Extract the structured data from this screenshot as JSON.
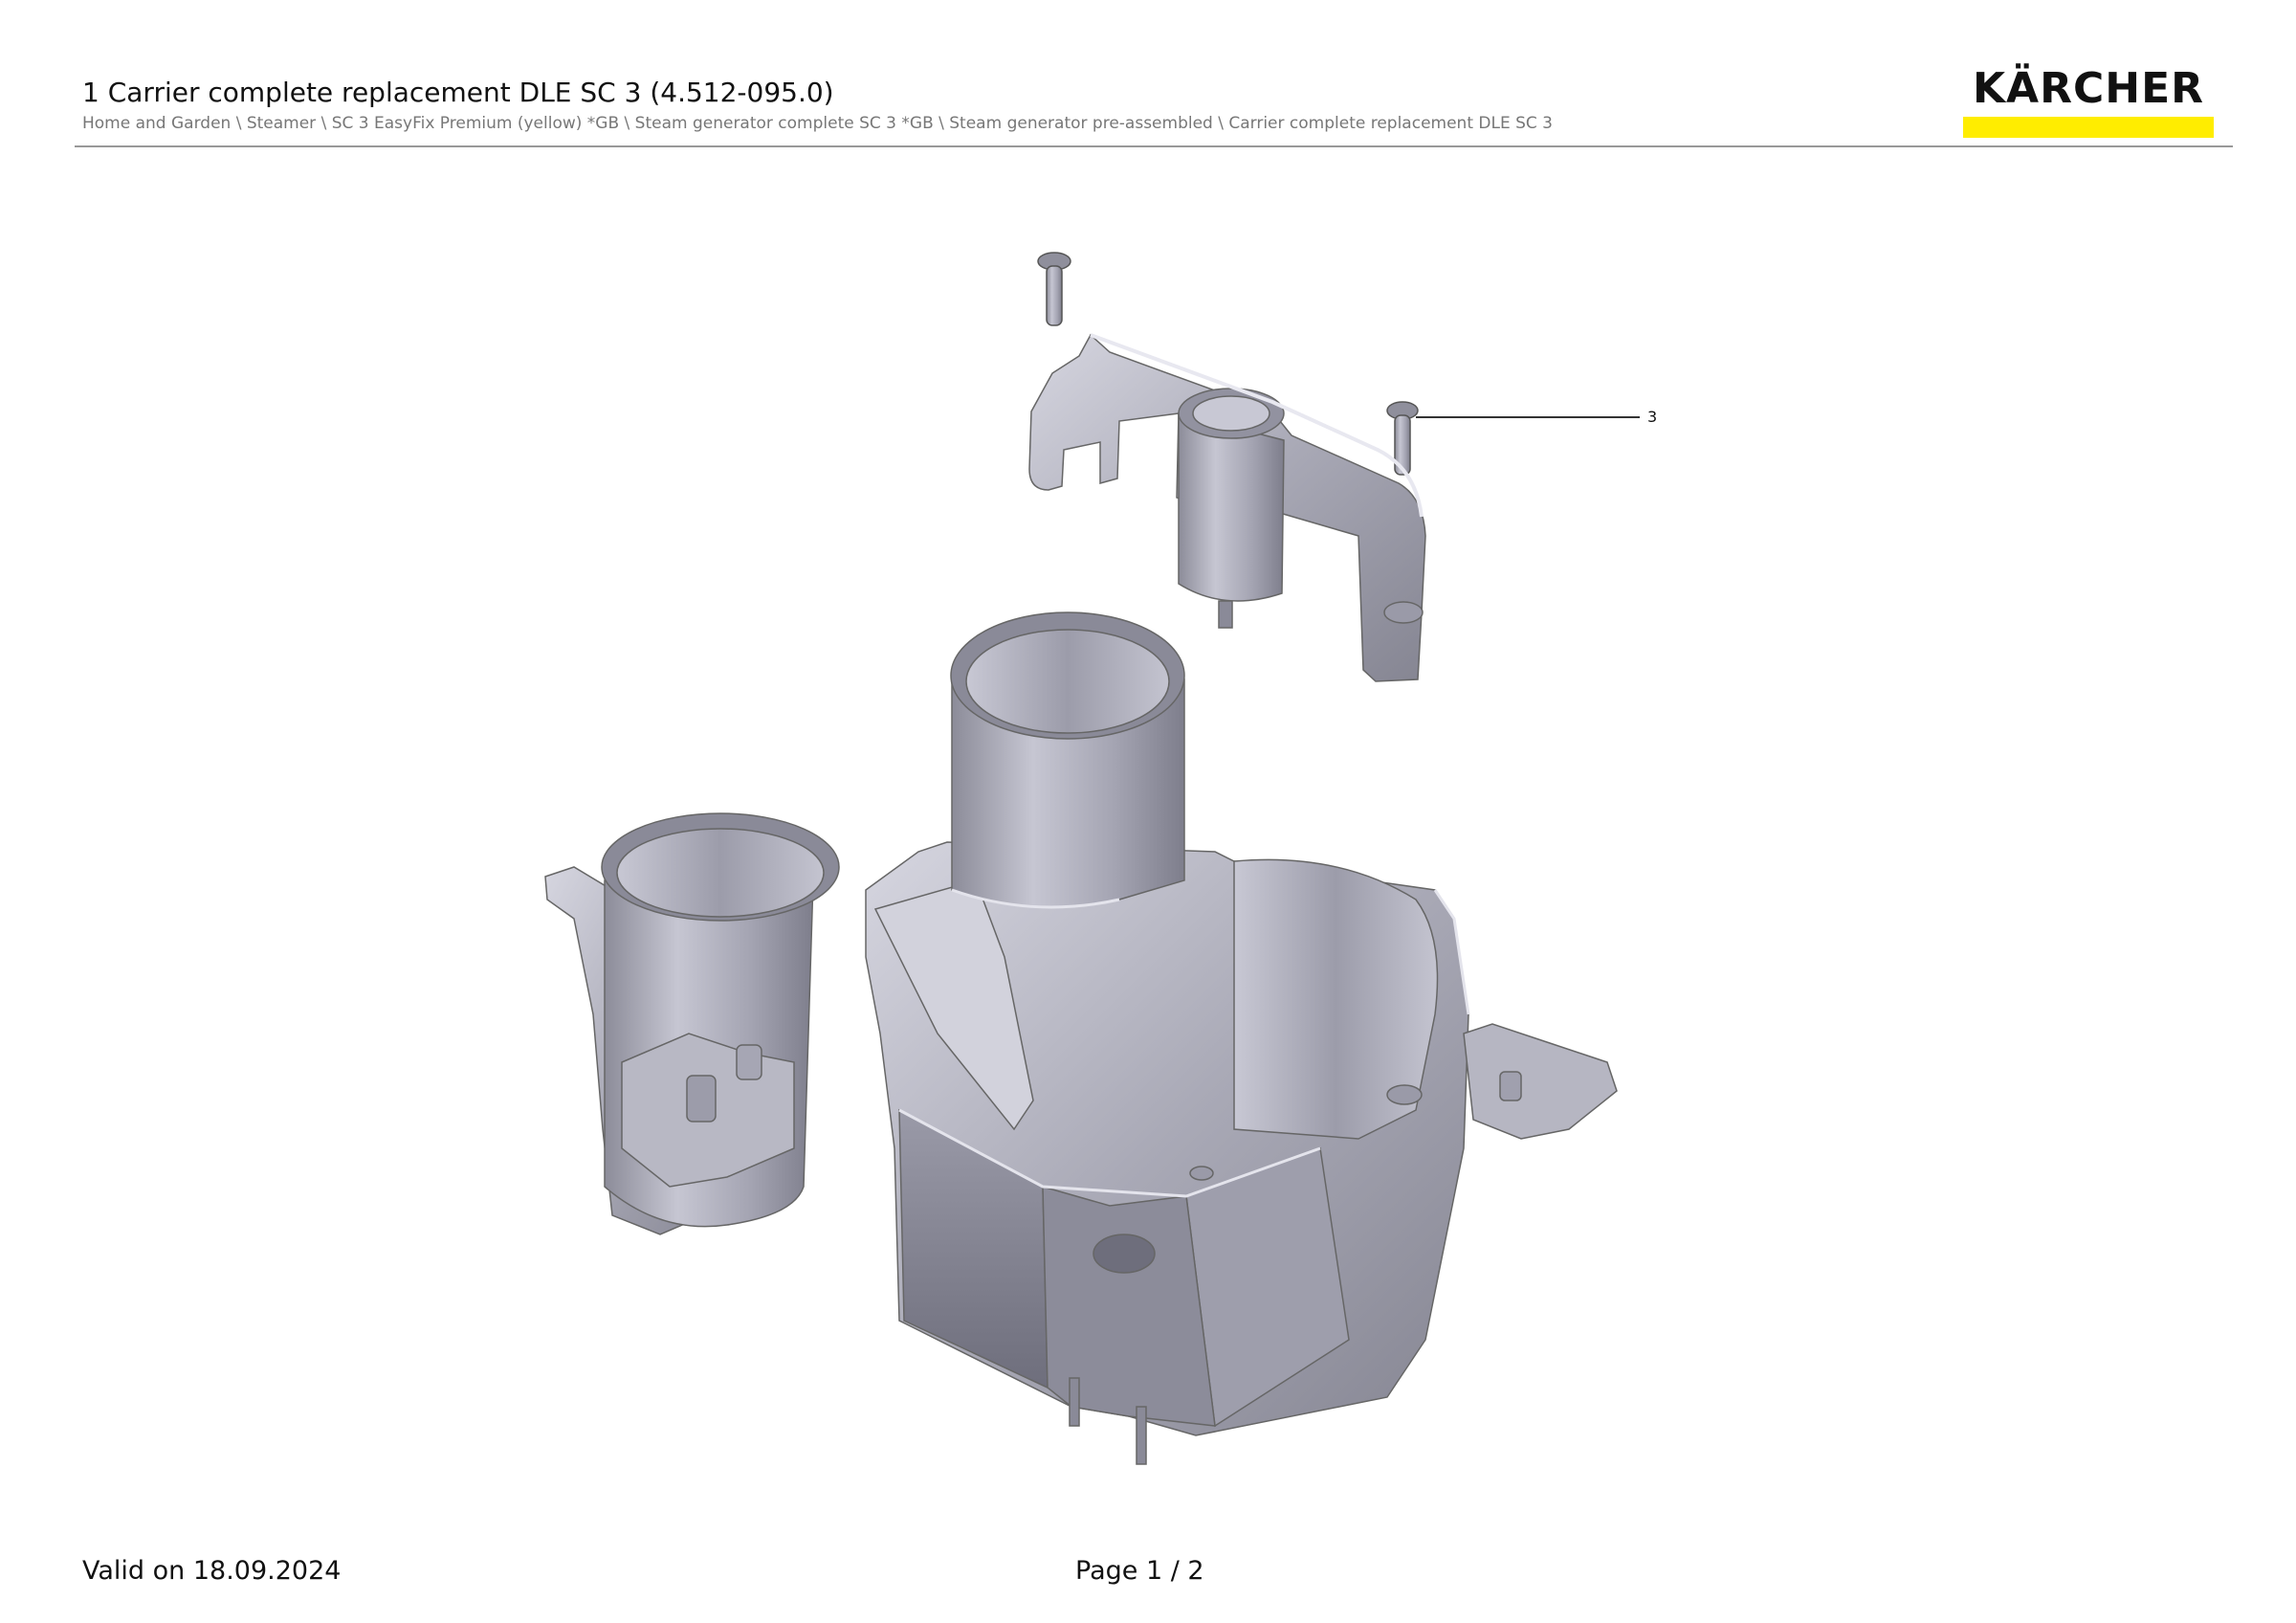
{
  "header": {
    "title": "1 Carrier complete replacement DLE SC 3 (4.512-095.0)",
    "breadcrumb": "Home and Garden \\ Steamer \\ SC 3 EasyFix Premium (yellow) *GB \\ Steam generator complete SC 3 *GB \\ Steam generator pre-assembled \\ Carrier complete replacement DLE SC 3"
  },
  "logo": {
    "text": "KÄRCHER",
    "bar_color": "#ffed00"
  },
  "drawing": {
    "callouts": [
      {
        "label": "3"
      }
    ],
    "part_color": "#b4b4c0"
  },
  "footer": {
    "valid": "Valid on 18.09.2024",
    "page": "Page 1 / 2"
  }
}
